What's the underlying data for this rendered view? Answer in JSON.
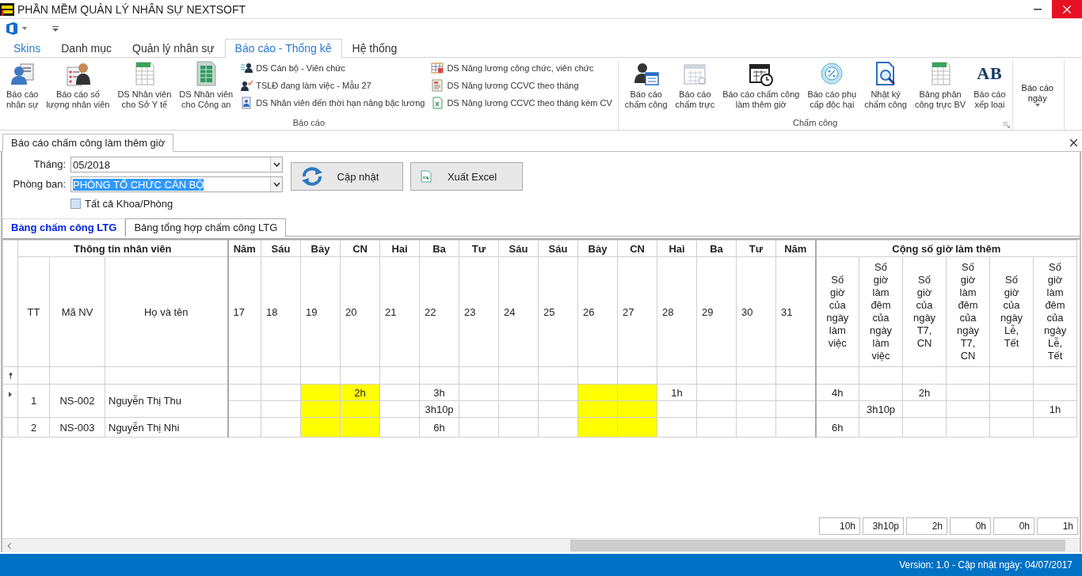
{
  "window": {
    "title": "PHẦN MỀM QUẢN LÝ NHÂN SỰ NEXTSOFT"
  },
  "ribbon_tabs": [
    {
      "label": "Skins",
      "kind": "skins",
      "selected": false
    },
    {
      "label": "Danh mục",
      "kind": "page",
      "selected": false
    },
    {
      "label": "Quản lý nhân sự",
      "kind": "page",
      "selected": false
    },
    {
      "label": "Báo cáo - Thống kê",
      "kind": "page",
      "selected": true
    },
    {
      "label": "Hệ thống",
      "kind": "page",
      "selected": false
    }
  ],
  "ribbon_groups": [
    {
      "title": "Báo cáo",
      "launcher": false,
      "items": [
        {
          "kind": "large",
          "label": "Báo cáo\nnhân sự"
        },
        {
          "kind": "large",
          "label": "Báo cáo số\nlượng nhân viên"
        },
        {
          "kind": "large",
          "label": "DS Nhân viên\ncho Sở Y tế"
        },
        {
          "kind": "large",
          "label": "DS Nhân viên\ncho Công an"
        },
        {
          "kind": "small",
          "label": "DS Cán bộ - Viên chức"
        },
        {
          "kind": "small",
          "label": "TSLĐ đang làm việc - Mẫu 27"
        },
        {
          "kind": "small",
          "label": "DS Nhân viên đến thời hạn nâng bậc lương"
        },
        {
          "kind": "small",
          "label": "DS Nâng lương công chức, viên chức"
        },
        {
          "kind": "small",
          "label": "DS Nâng lương CCVC theo tháng"
        },
        {
          "kind": "small",
          "label": "DS Nâng lương CCVC theo tháng kèm CV"
        }
      ]
    },
    {
      "title": "Chấm công",
      "launcher": true,
      "items": [
        {
          "kind": "large",
          "label": "Báo cáo\nchấm công"
        },
        {
          "kind": "large",
          "label": "Báo cáo\nchấm trực"
        },
        {
          "kind": "large",
          "label": "Báo cáo chấm công\nlàm thêm giờ"
        },
        {
          "kind": "large",
          "label": "Báo cáo phụ\ncấp độc hại"
        },
        {
          "kind": "large",
          "label": "Nhật ký\nchấm công"
        },
        {
          "kind": "large",
          "label": "Bảng phân\ncông trực BV"
        },
        {
          "kind": "large",
          "label": "Báo cáo\nxếp loại",
          "icon_text": "AB"
        }
      ]
    },
    {
      "launcher": false,
      "items": [
        {
          "kind": "dropdown",
          "label": "Báo cáo\nngày"
        }
      ]
    }
  ],
  "document_tab": {
    "label": "Báo cáo chấm công làm thêm giờ"
  },
  "filters": {
    "month": {
      "label": "Tháng:",
      "value": "05/2018"
    },
    "department": {
      "label": "Phòng ban:",
      "value": "PHÒNG TỔ CHỨC CÁN BỘ",
      "highlighted": true
    },
    "all_departments": {
      "label": "Tất cả Khoa/Phòng",
      "checked": false
    }
  },
  "buttons": [
    {
      "kind": "refresh",
      "label": "Cập nhật"
    },
    {
      "kind": "excel",
      "label": "Xuất Excel"
    }
  ],
  "sub_tabs": [
    {
      "label": "Bảng chấm công LTG",
      "selected": true
    },
    {
      "label": "Bảng tổng hợp chấm công LTG",
      "selected": false
    }
  ],
  "grid": {
    "info_band": "Thông tin nhân viên",
    "info_columns": [
      "TT",
      "Mã NV",
      "Họ và tên"
    ],
    "days": [
      {
        "weekday": "Năm",
        "day": "17",
        "weekend": false
      },
      {
        "weekday": "Sáu",
        "day": "18",
        "weekend": false
      },
      {
        "weekday": "Bảy",
        "day": "19",
        "weekend": true
      },
      {
        "weekday": "CN",
        "day": "20",
        "weekend": true
      },
      {
        "weekday": "Hai",
        "day": "21",
        "weekend": false
      },
      {
        "weekday": "Ba",
        "day": "22",
        "weekend": false
      },
      {
        "weekday": "Tư",
        "day": "23",
        "weekend": false
      },
      {
        "weekday": "Sáu",
        "day": "24",
        "weekend": false
      },
      {
        "weekday": "Sáu",
        "day": "25",
        "weekend": false
      },
      {
        "weekday": "Bảy",
        "day": "26",
        "weekend": true
      },
      {
        "weekday": "CN",
        "day": "27",
        "weekend": true
      },
      {
        "weekday": "Hai",
        "day": "28",
        "weekend": false
      },
      {
        "weekday": "Ba",
        "day": "29",
        "weekend": false
      },
      {
        "weekday": "Tư",
        "day": "30",
        "weekend": false
      },
      {
        "weekday": "Năm",
        "day": "31",
        "weekend": false
      }
    ],
    "summary_band": "Cộng số giờ làm thêm",
    "summary_columns": [
      "Số giờ của ngày làm việc",
      "Số giờ làm đêm của ngày làm việc",
      "Số giờ của ngày T7, CN",
      "Số giờ làm đêm của ngày T7, CN",
      "Số giờ của ngày Lễ, Tết",
      "Số giờ làm đêm của ngày Lễ, Tết"
    ],
    "employees": [
      {
        "tt": "1",
        "code": "NS-002",
        "name": "Nguyễn Thị Thu",
        "current": true,
        "lines": [
          {
            "days": {
              "3": "2h",
              "5": "3h",
              "11": "1h"
            },
            "totals": {
              "0": "4h",
              "2": "2h"
            }
          },
          {
            "days": {
              "5": "3h10p"
            },
            "totals": {
              "1": "3h10p",
              "5": "1h"
            }
          }
        ]
      },
      {
        "tt": "2",
        "code": "NS-003",
        "name": "Nguyễn Thị Nhi",
        "current": false,
        "lines": [
          {
            "days": {
              "5": "6h"
            },
            "totals": {
              "0": "6h"
            }
          }
        ]
      }
    ],
    "footer_totals": [
      "10h",
      "3h10p",
      "2h",
      "0h",
      "0h",
      "1h"
    ]
  },
  "status_bar": {
    "text": "Version: 1.0 - Cập nhật ngày: 04/07/2017"
  }
}
